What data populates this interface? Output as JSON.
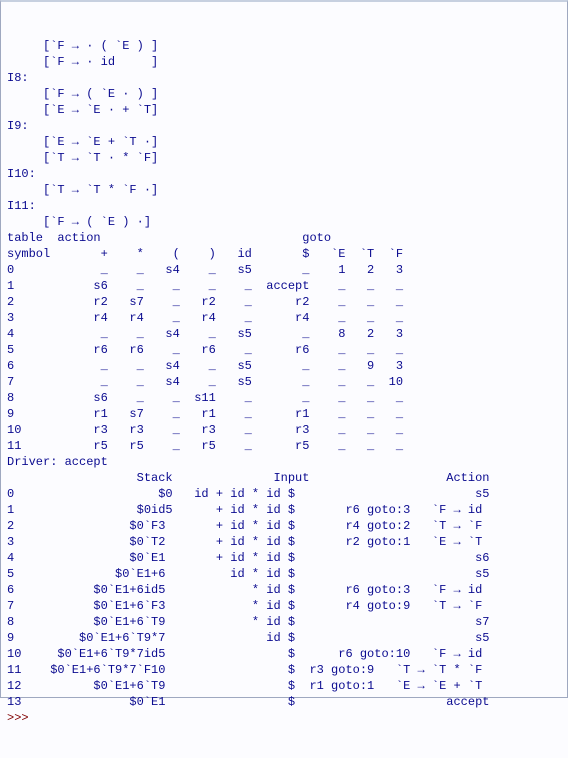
{
  "lines": [
    "     [`F → · ( `E ) ]",
    "     [`F → · id     ]",
    "I8:",
    "     [`F → ( `E · ) ]",
    "     [`E → `E · + `T]",
    "I9:",
    "     [`E → `E + `T ·]",
    "     [`T → `T · * `F]",
    "I10:",
    "     [`T → `T * `F ·]",
    "I11:",
    "     [`F → ( `E ) ·]",
    "table  action                            goto",
    "symbol       +    *    (    )   id       $   `E  `T  `F",
    "0            _    _   s4    _   s5       _    1   2   3",
    "1           s6    _    _    _    _  accept    _   _   _",
    "2           r2   s7    _   r2    _      r2    _   _   _",
    "3           r4   r4    _   r4    _      r4    _   _   _",
    "4            _    _   s4    _   s5       _    8   2   3",
    "5           r6   r6    _   r6    _      r6    _   _   _",
    "6            _    _   s4    _   s5       _    _   9   3",
    "7            _    _   s4    _   s5       _    _   _  10",
    "8           s6    _    _  s11    _       _    _   _   _",
    "9           r1   s7    _   r1    _      r1    _   _   _",
    "10          r3   r3    _   r3    _      r3    _   _   _",
    "11          r5   r5    _   r5    _      r5    _   _   _",
    "Driver: accept",
    "                  Stack              Input                   Action",
    "0                    $0   id + id * id $                         s5",
    "1                 $0id5      + id * id $       r6 goto:3   `F → id",
    "2                $0`F3       + id * id $       r4 goto:2   `T → `F",
    "3                $0`T2       + id * id $       r2 goto:1   `E → `T",
    "4                $0`E1       + id * id $                         s6",
    "5              $0`E1+6         id * id $                         s5",
    "6           $0`E1+6id5            * id $       r6 goto:3   `F → id",
    "7           $0`E1+6`F3            * id $       r4 goto:9   `T → `F",
    "8           $0`E1+6`T9            * id $                         s7",
    "9         $0`E1+6`T9*7              id $                         s5",
    "10     $0`E1+6`T9*7id5                 $      r6 goto:10   `F → id",
    "11    $0`E1+6`T9*7`F10                 $  r3 goto:9   `T → `T * `F",
    "12          $0`E1+6`T9                 $  r1 goto:1   `E → `E + `T",
    "13               $0`E1                 $                     accept"
  ],
  "prompt": ">>>"
}
